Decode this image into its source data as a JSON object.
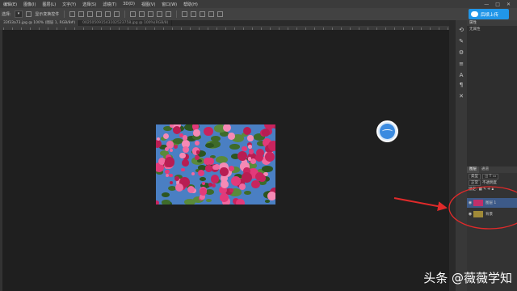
{
  "menu": {
    "items": [
      "编辑(E)",
      "图像(I)",
      "图层(L)",
      "文字(Y)",
      "选择(S)",
      "滤镜(T)",
      "3D(D)",
      "视图(V)",
      "窗口(W)",
      "帮助(H)"
    ],
    "window_controls": [
      "—",
      "□",
      "✕"
    ]
  },
  "options": {
    "mode_label": "选择:",
    "check_label": "显示变换控件"
  },
  "upload_button": {
    "label": "后续上传"
  },
  "tabs": [
    {
      "label": "33f33a73.jpg @ 100% (图层 1, RGB/8#)"
    },
    {
      "label": "002505091543102523758.jpg @ 100%(RGB/8)"
    }
  ],
  "panel": {
    "props_title": "属性",
    "props_body": "无属性"
  },
  "layers": {
    "tabs": [
      "图层",
      "通道"
    ],
    "kind_label": "类型",
    "blend_mode": "正常",
    "opacity_label": "不透明度",
    "lock_label": "锁定:",
    "items": [
      {
        "name": "图层 1",
        "selected": true
      },
      {
        "name": "背景",
        "selected": false
      }
    ]
  },
  "watermark": "头条 @薇薇学知"
}
